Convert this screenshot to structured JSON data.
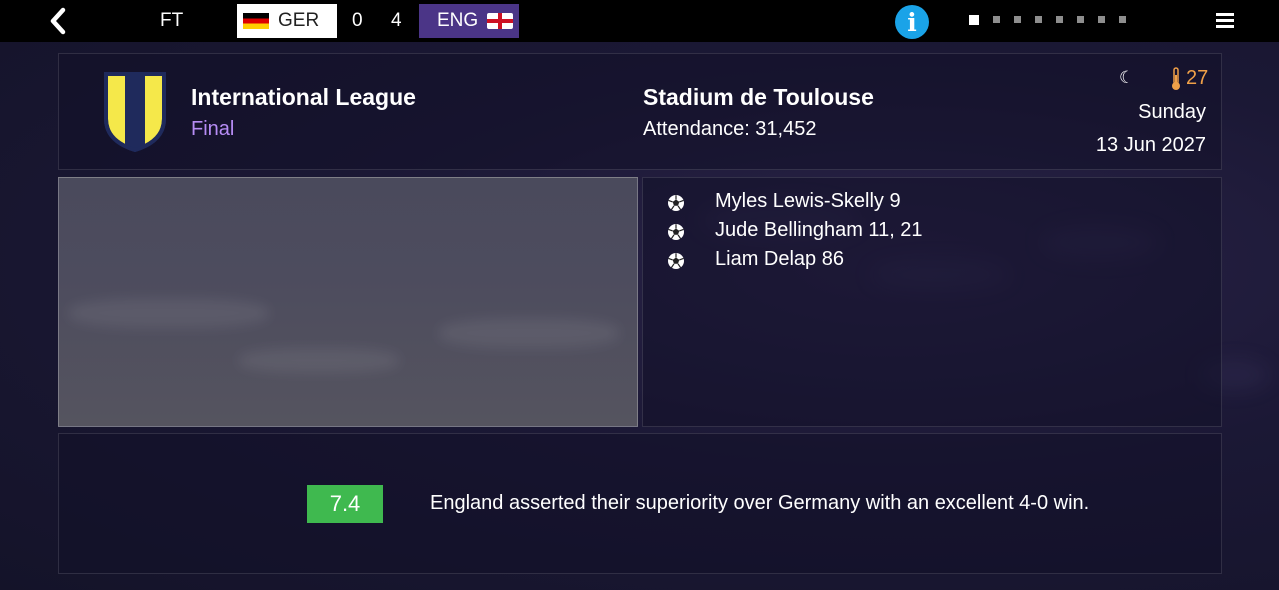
{
  "header": {
    "status": "FT",
    "home_team": {
      "code": "GER",
      "score": "0",
      "flag": "germany-flag"
    },
    "away_team": {
      "code": "ENG",
      "score": "4",
      "flag": "england-flag"
    },
    "pager": {
      "page_count": 8,
      "current_page": 1
    }
  },
  "match_info": {
    "competition": "International League",
    "stage": "Final",
    "stadium": "Stadium de Toulouse",
    "attendance": "Attendance: 31,452",
    "temperature": "27",
    "day": "Sunday",
    "date": "13 Jun 2027"
  },
  "scorers": [
    {
      "text": "Myles Lewis-Skelly 9"
    },
    {
      "text": "Jude Bellingham 11, 21"
    },
    {
      "text": "Liam Delap 86"
    }
  ],
  "summary": {
    "rating": "7.4",
    "text": "England asserted their superiority over Germany with an excellent 4-0 win."
  },
  "colors": {
    "away_team_bg": "#4b3587",
    "stage_text": "#b68cf5",
    "rating_bg": "#3fb94f",
    "info_icon": "#1aa3e8",
    "temperature": "#f0a048",
    "crest_yellow": "#f5e84a",
    "crest_navy": "#1f2a5c"
  }
}
